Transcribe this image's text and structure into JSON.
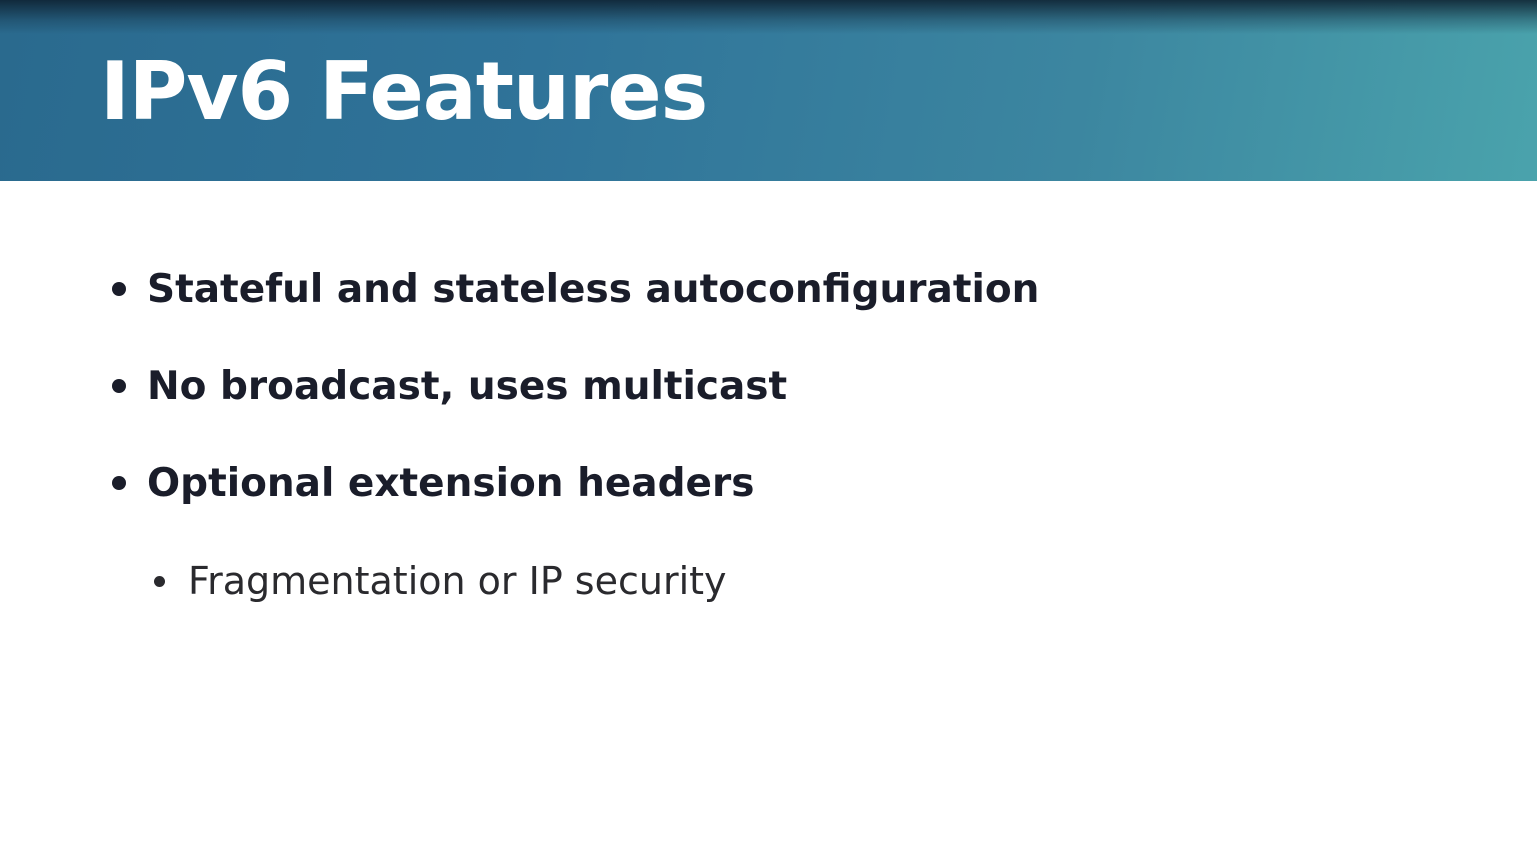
{
  "slide": {
    "title": "IPv6 Features",
    "bullets": [
      {
        "text": "Stateful and stateless autoconfiguration",
        "level": 1
      },
      {
        "text": "No broadcast, uses multicast",
        "level": 1
      },
      {
        "text": "Optional extension headers",
        "level": 1
      },
      {
        "text": "Fragmentation or IP security",
        "level": 2
      }
    ]
  },
  "colors": {
    "header_start": "#2a6a8e",
    "header_end": "#4aa3ac",
    "title_text": "#ffffff",
    "body_text": "#1a1d2a",
    "background": "#ffffff"
  }
}
